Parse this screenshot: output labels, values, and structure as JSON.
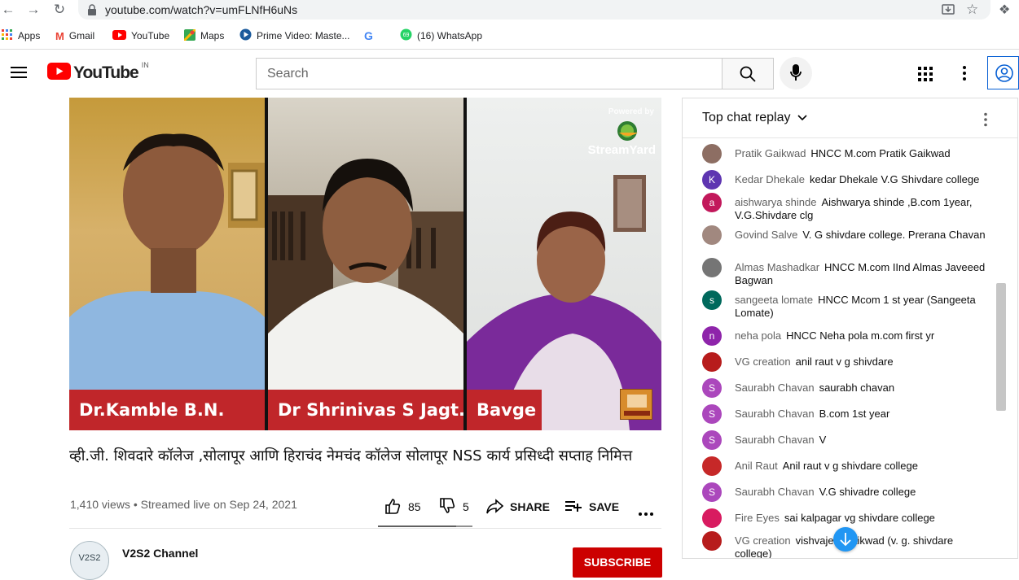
{
  "browser": {
    "url": "youtube.com/watch?v=umFLNfH6uNs",
    "bookmarks": [
      {
        "label": "Apps",
        "color": "#4285f4"
      },
      {
        "label": "Gmail",
        "color": "#ea4335"
      },
      {
        "label": "YouTube",
        "color": "#ff0000"
      },
      {
        "label": "Maps",
        "color": "#34a853"
      },
      {
        "label": "Prime Video: Maste...",
        "color": "#1a98ff"
      },
      {
        "label": "",
        "color": "#4285f4"
      },
      {
        "label": "(16) WhatsApp",
        "color": "#25d366"
      }
    ]
  },
  "youtube": {
    "logo_text": "YouTube",
    "region": "IN",
    "search_placeholder": "Search"
  },
  "video": {
    "names": [
      "Dr.Kamble B.N.",
      "Dr Shrinivas S Jagt...",
      "Bavge"
    ],
    "powered_by": "Powered by",
    "streamyard": "StreamYard",
    "title": "व्ही.जी. शिवदारे कॉलेज ,सोलापूर आणि हिराचंद नेमचंद कॉलेज सोलापूर NSS कार्य प्रसिध्दी सप्ताह निमित्त",
    "meta": "1,410 views • Streamed live on Sep 24, 2021",
    "likes": "85",
    "dislikes": "5",
    "share": "SHARE",
    "save": "SAVE",
    "channel": "V2S2 Channel",
    "channel_avatar_text": "V2S2",
    "subscribe": "SUBSCRIBE"
  },
  "chat": {
    "header": "Top chat replay",
    "messages": [
      {
        "author": "Pratik Gaikwad",
        "text": "HNCC M.com Pratik Gaikwad",
        "avatar": "",
        "color": "#8d6e63"
      },
      {
        "author": "Kedar Dhekale",
        "text": "kedar Dhekale V.G Shivdare college",
        "avatar": "K",
        "color": "#5e35b1"
      },
      {
        "author": "aishwarya shinde",
        "text": "Aishwarya shinde ,B.com 1year, V.G.Shivdare clg",
        "avatar": "a",
        "color": "#c2185b"
      },
      {
        "author": "Govind Salve",
        "text": "V. G shivdare college. Prerana Chavan",
        "avatar": "",
        "color": "#a1887f"
      },
      {
        "author": "Almas Mashadkar",
        "text": "HNCC M.com IInd Almas Javeeed Bagwan",
        "avatar": "",
        "color": "#757575"
      },
      {
        "author": "sangeeta lomate",
        "text": "HNCC Mcom 1 st year (Sangeeta Lomate)",
        "avatar": "s",
        "color": "#00695c"
      },
      {
        "author": "neha pola",
        "text": "HNCC Neha pola m.com first yr",
        "avatar": "n",
        "color": "#8e24aa"
      },
      {
        "author": "VG creation",
        "text": "anil raut v g shivdare",
        "avatar": "",
        "color": "#b71c1c"
      },
      {
        "author": "Saurabh Chavan",
        "text": "saurabh chavan",
        "avatar": "S",
        "color": "#ab47bc"
      },
      {
        "author": "Saurabh Chavan",
        "text": "B.com 1st year",
        "avatar": "S",
        "color": "#ab47bc"
      },
      {
        "author": "Saurabh Chavan",
        "text": "V",
        "avatar": "S",
        "color": "#ab47bc"
      },
      {
        "author": "Anil Raut",
        "text": "Anil raut v g shivdare college",
        "avatar": "",
        "color": "#c62828"
      },
      {
        "author": "Saurabh Chavan",
        "text": "V.G shivadre college",
        "avatar": "S",
        "color": "#ab47bc"
      },
      {
        "author": "Fire Eyes",
        "text": "sai kalpagar vg shivdare college",
        "avatar": "",
        "color": "#d81b60"
      },
      {
        "author": "VG creation",
        "text": "vishvajeet gaikwad (v. g. shivdare college)",
        "avatar": "",
        "color": "#b71c1c"
      }
    ]
  },
  "colors": {
    "accent": "#ff0000",
    "namebar": "#c0262a",
    "link": "#065fd4"
  }
}
